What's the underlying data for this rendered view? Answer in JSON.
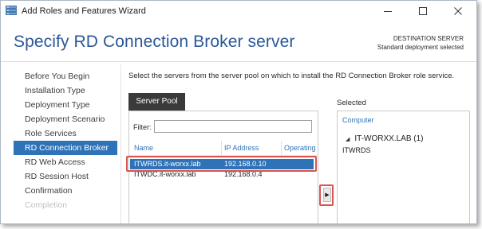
{
  "window": {
    "title": "Add Roles and Features Wizard",
    "icons": {
      "app": "server-manager-icon",
      "minimize": "minimize-icon",
      "maximize": "maximize-icon",
      "close": "close-icon"
    }
  },
  "header": {
    "title": "Specify RD Connection Broker server",
    "destination_label": "DESTINATION SERVER",
    "destination_value": "Standard deployment selected"
  },
  "sidebar": {
    "items": [
      {
        "label": "Before You Begin",
        "state": "normal"
      },
      {
        "label": "Installation Type",
        "state": "normal"
      },
      {
        "label": "Deployment Type",
        "state": "normal"
      },
      {
        "label": "Deployment Scenario",
        "state": "normal"
      },
      {
        "label": "Role Services",
        "state": "normal"
      },
      {
        "label": "RD Connection Broker",
        "state": "active"
      },
      {
        "label": "RD Web Access",
        "state": "normal"
      },
      {
        "label": "RD Session Host",
        "state": "normal"
      },
      {
        "label": "Confirmation",
        "state": "normal"
      },
      {
        "label": "Completion",
        "state": "disabled"
      }
    ]
  },
  "main": {
    "instruction": "Select the servers from the server pool on which to install the RD Connection Broker role service.",
    "server_pool": {
      "tab_label": "Server Pool",
      "filter_label": "Filter:",
      "filter_value": "",
      "columns": [
        "Name",
        "IP Address",
        "Operating"
      ],
      "rows": [
        {
          "name": "ITWRDS.it-worxx.lab",
          "ip": "192.168.0.10",
          "selected": true
        },
        {
          "name": "ITWDC.it-worxx.lab",
          "ip": "192.168.0.4",
          "selected": false
        }
      ]
    },
    "add_button": {
      "glyph": "▶",
      "icon": "arrow-right-icon"
    },
    "selected": {
      "label": "Selected",
      "column": "Computer",
      "group": "IT-WORXX.LAB (1)",
      "items": [
        "ITWRDS"
      ]
    }
  },
  "colors": {
    "accent": "#2e72b8",
    "title": "#2b5797",
    "highlight_box": "#d9534f",
    "tab_dark": "#3a3a3a"
  }
}
